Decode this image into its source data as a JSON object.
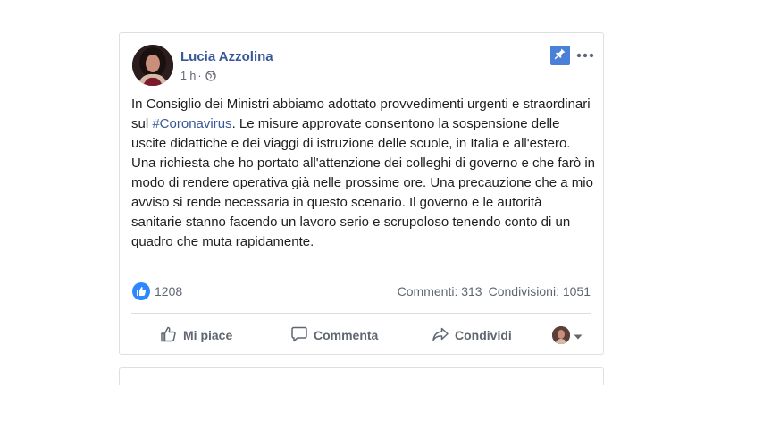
{
  "post": {
    "author": "Lucia Azzolina",
    "time": "1 h",
    "separator": "·",
    "text_before_hashtag": "In Consiglio dei Ministri abbiamo adottato provvedimenti urgenti e straordinari sul ",
    "hashtag": "#Coronavirus",
    "text_after_hashtag": ". Le misure approvate consentono la sospensione delle uscite didattiche e dei viaggi di istruzione delle scuole, in Italia e all'estero. Una richiesta che ho portato all'attenzione dei colleghi di governo e che farò in modo di rendere operativa già nelle prossime ore. Una precauzione che a mio avviso si rende necessaria in questo scenario. Il governo e le autorità sanitarie stanno facendo un lavoro serio e scrupoloso tenendo conto di un quadro che muta rapidamente.",
    "reactions_count": "1208",
    "comments": "Commenti: 313",
    "shares": "Condivisioni: 1051"
  },
  "actions": {
    "like": "Mi piace",
    "comment": "Commenta",
    "share": "Condividi"
  },
  "icons": {
    "pin": "pin-icon",
    "more": "more-options-icon",
    "globe": "globe-icon",
    "like": "thumbs-up-icon",
    "comment": "comment-icon",
    "share": "share-arrow-icon",
    "audience": "chevron-down-icon"
  },
  "colors": {
    "author_link": "#385898",
    "pin_button": "#4a80d8",
    "like_badge": "#2d88ff",
    "secondary_text": "#606770"
  }
}
